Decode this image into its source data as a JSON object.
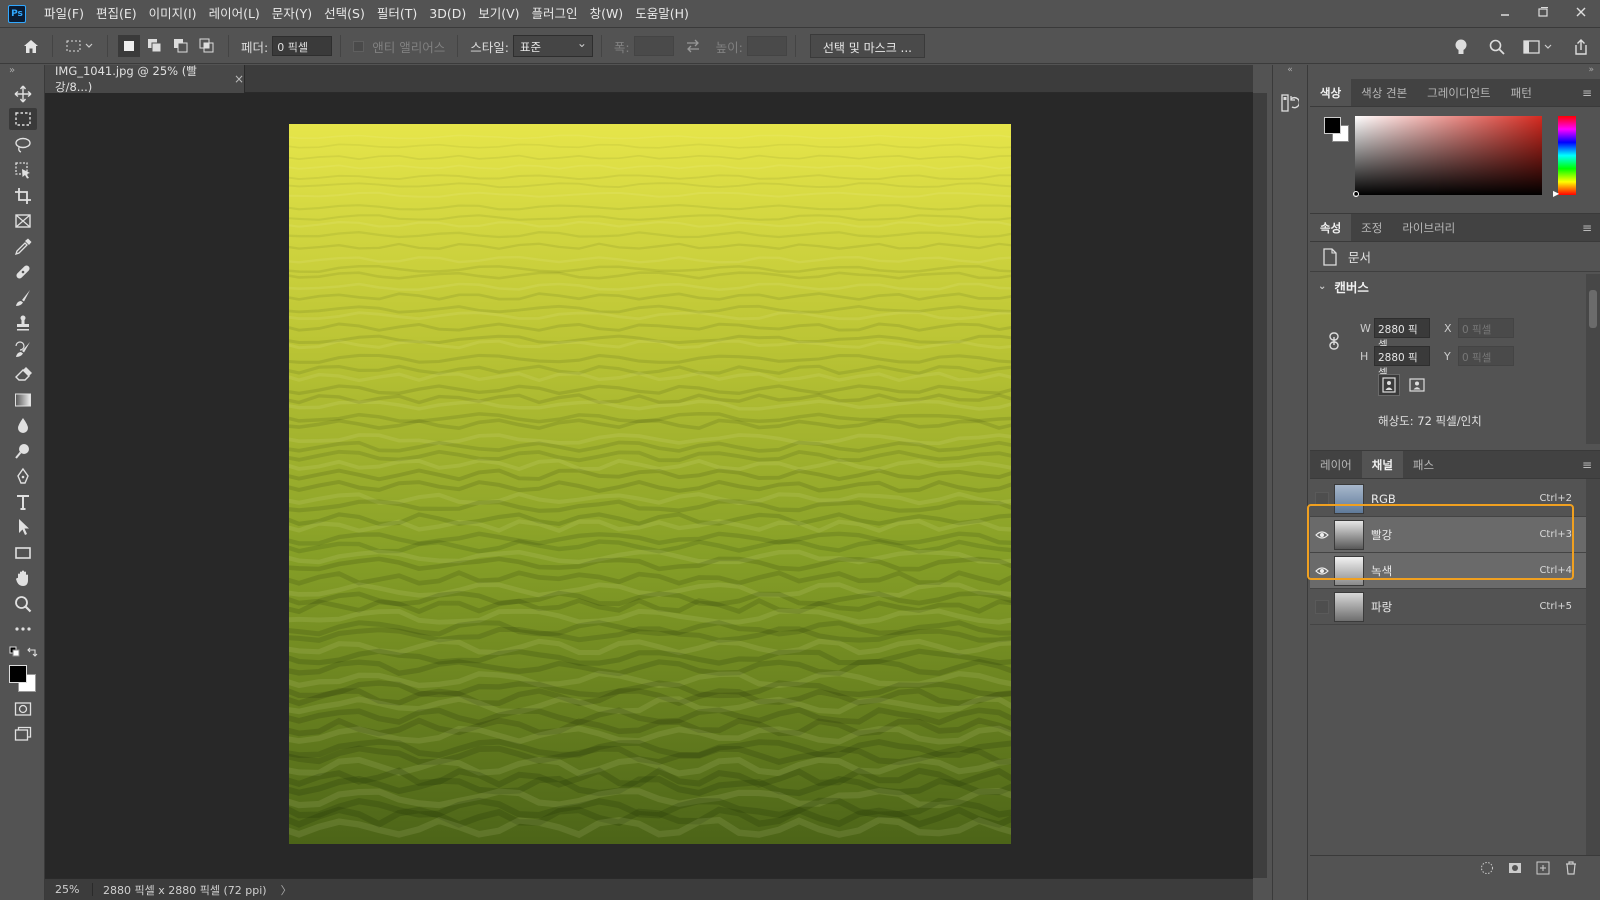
{
  "app": {
    "logo": "Ps",
    "menu": [
      "파일(F)",
      "편집(E)",
      "이미지(I)",
      "레이어(L)",
      "문자(Y)",
      "선택(S)",
      "필터(T)",
      "3D(D)",
      "보기(V)",
      "플러그인",
      "창(W)",
      "도움말(H)"
    ]
  },
  "options": {
    "feather_label": "페더:",
    "feather_value": "0 픽셀",
    "antialias_label": "앤티 앨리어스",
    "style_label": "스타일:",
    "style_value": "표준",
    "width_label": "폭:",
    "height_label": "높이:",
    "mask_button": "선택 및 마스크 ..."
  },
  "document": {
    "tab_title": "IMG_1041.jpg @ 25% (빨강/8...)",
    "tab_close": "×",
    "zoom": "25%",
    "info": "2880 픽셀 x 2880 픽셀 (72 ppi)",
    "info_arrow": "〉"
  },
  "color_panel": {
    "tabs": [
      "색상",
      "색상 견본",
      "그레이디언트",
      "패턴"
    ],
    "foreground": "#000000",
    "background": "#ffffff"
  },
  "properties_panel": {
    "tabs": [
      "속성",
      "조정",
      "라이브러리"
    ],
    "doc_label": "문서",
    "section_title": "캔버스",
    "w_label": "W",
    "w_value": "2880 픽셀",
    "h_label": "H",
    "h_value": "2880 픽셀",
    "x_label": "X",
    "x_value": "0 픽셀",
    "y_label": "Y",
    "y_value": "0 픽셀",
    "resolution": "해상도: 72 픽셀/인치"
  },
  "channels_panel": {
    "tabs": [
      "레이어",
      "채널",
      "패스"
    ],
    "channels": [
      {
        "name": "RGB",
        "shortcut": "Ctrl+2",
        "visible": false,
        "selected": false
      },
      {
        "name": "빨강",
        "shortcut": "Ctrl+3",
        "visible": true,
        "selected": true
      },
      {
        "name": "녹색",
        "shortcut": "Ctrl+4",
        "visible": true,
        "selected": true
      },
      {
        "name": "파랑",
        "shortcut": "Ctrl+5",
        "visible": false,
        "selected": false
      }
    ]
  },
  "colors": {
    "highlight": "#f0a020",
    "image_top": "#e6e54a",
    "image_bottom": "#4c6418"
  }
}
